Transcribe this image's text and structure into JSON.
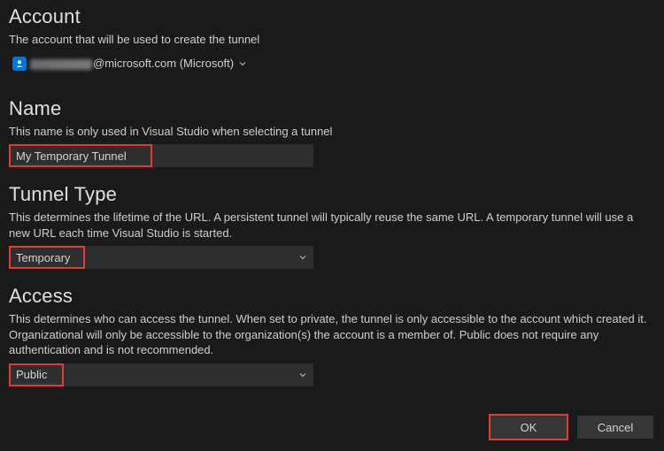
{
  "account": {
    "title": "Account",
    "description": "The account that will be used to create the tunnel",
    "display_suffix": "@microsoft.com (Microsoft)",
    "icon": "account-badge-icon"
  },
  "name": {
    "title": "Name",
    "description": "This name is only used in Visual Studio when selecting a tunnel",
    "value": "My Temporary Tunnel"
  },
  "tunnel_type": {
    "title": "Tunnel Type",
    "description": "This determines the lifetime of the URL. A persistent tunnel will typically reuse the same URL. A temporary tunnel will use a new URL each time Visual Studio is started.",
    "selected": "Temporary"
  },
  "access": {
    "title": "Access",
    "description": "This determines who can access the tunnel. When set to private, the tunnel is only accessible to the account which created it. Organizational will only be accessible to the organization(s) the account is a member of. Public does not require any authentication and is not recommended.",
    "selected": "Public"
  },
  "footer": {
    "ok": "OK",
    "cancel": "Cancel"
  },
  "colors": {
    "highlight": "#e53935",
    "accent": "#0078d4",
    "bg": "#1a1a1a",
    "field": "#2e2e2e"
  }
}
